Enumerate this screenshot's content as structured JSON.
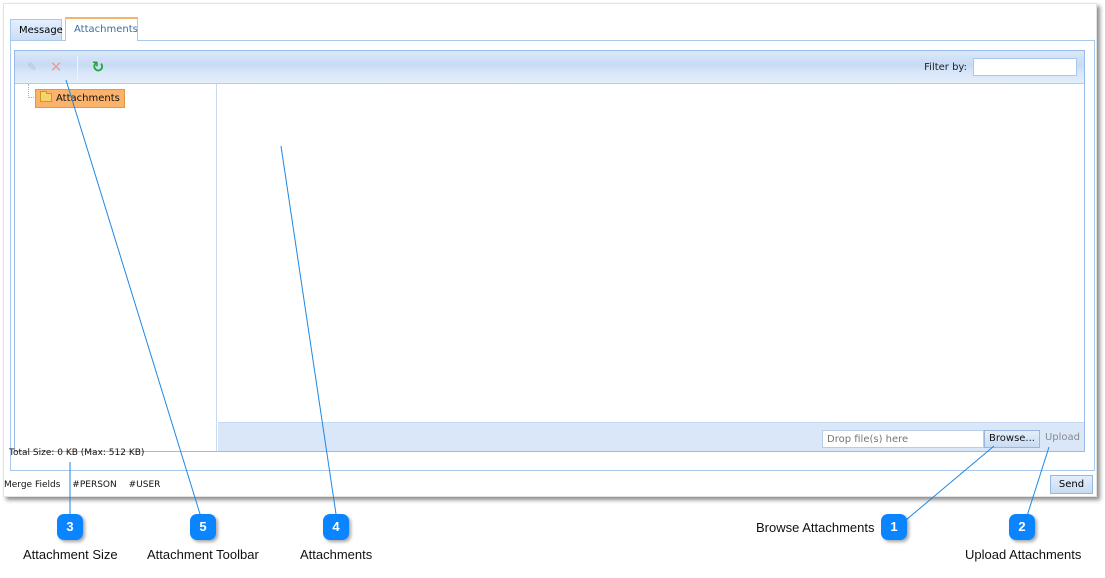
{
  "tabs": [
    {
      "label": "Message",
      "active": false
    },
    {
      "label": "Attachments",
      "active": true
    }
  ],
  "toolbar": {
    "edit_icon": "edit-icon",
    "delete_icon": "delete-icon",
    "refresh_icon": "refresh-icon",
    "filter_label": "Filter by:",
    "filter_value": ""
  },
  "tree": {
    "root": {
      "label": "Attachments",
      "icon": "folder-icon",
      "selected": true
    }
  },
  "upload": {
    "drop_placeholder": "Drop file(s) here",
    "browse_label": "Browse...",
    "upload_label": "Upload"
  },
  "total_size": "Total Size: 0 KB (Max: 512 KB)",
  "merge_fields": {
    "label": "Merge Fields",
    "fields": [
      "#PERSON",
      "#USER"
    ]
  },
  "send_label": "Send",
  "colors": {
    "accent": "#0a84ff",
    "selected_node": "#fbb26a",
    "toolbar": "#c7dbf4"
  },
  "callouts": [
    {
      "number": "1",
      "label": "Browse Attachments"
    },
    {
      "number": "2",
      "label": "Upload Attachments"
    },
    {
      "number": "3",
      "label": "Attachment Size"
    },
    {
      "number": "4",
      "label": "Attachments"
    },
    {
      "number": "5",
      "label": "Attachment Toolbar"
    }
  ]
}
